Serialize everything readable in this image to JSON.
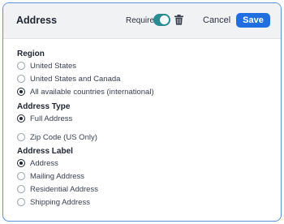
{
  "header": {
    "title": "Address",
    "required_label": "Required",
    "required_on": true,
    "cancel_label": "Cancel",
    "save_label": "Save"
  },
  "region": {
    "heading": "Region",
    "options": [
      {
        "label": "United States",
        "selected": false
      },
      {
        "label": "United States and Canada",
        "selected": false
      },
      {
        "label": "All available countries (international)",
        "selected": true
      }
    ]
  },
  "address_type": {
    "heading": "Address Type",
    "options": [
      {
        "label": "Full Address",
        "selected": true
      },
      {
        "label": "Zip Code (US Only)",
        "selected": false
      }
    ]
  },
  "address_label": {
    "heading": "Address Label",
    "options": [
      {
        "label": "Address",
        "selected": true
      },
      {
        "label": "Mailing Address",
        "selected": false
      },
      {
        "label": "Residential Address",
        "selected": false
      },
      {
        "label": "Shipping Address",
        "selected": false
      }
    ]
  },
  "colors": {
    "accent": "#1f6fe0",
    "toggle_on": "#2a8c92",
    "border": "#5b8fd8"
  },
  "icons": {
    "delete": "trash-icon"
  }
}
